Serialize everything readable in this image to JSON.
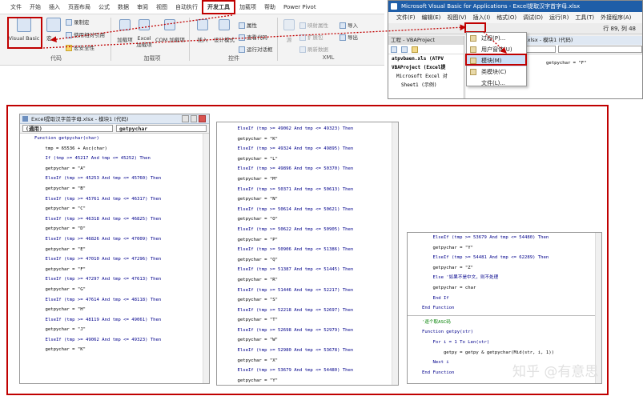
{
  "ribbon": {
    "tabs": [
      "文件",
      "开始",
      "插入",
      "页面布局",
      "公式",
      "数据",
      "审阅",
      "视图",
      "自动执行",
      "开发工具",
      "加载项",
      "帮助",
      "Power Pivot"
    ],
    "active_tab": "开发工具",
    "code_group": {
      "visual_basic": "Visual Basic",
      "macros": "宏",
      "record_macro": "录制宏",
      "relative_ref": "使用相对引用",
      "macro_security": "宏安全性",
      "label": "代码"
    },
    "addins_group": {
      "addins": "加载项",
      "excel_addins": "Excel 加载项",
      "com_addins": "COM 加载项",
      "label": "加载项"
    },
    "controls_group": {
      "insert": "插入",
      "design_mode": "设计模式",
      "properties": "属性",
      "view_code": "查看代码",
      "run_dialog": "运行对话框",
      "label": "控件"
    },
    "xml_group": {
      "source": "源",
      "map_properties": "映射属性",
      "expansion_packs": "扩展包",
      "refresh_data": "刷新数据",
      "import": "导入",
      "export": "导出",
      "label": "XML"
    }
  },
  "vbe": {
    "title": "Microsoft Visual Basic for Applications - Excel提取汉字首字母.xlsx",
    "menu": [
      "文件(F)",
      "编辑(E)",
      "视图(V)",
      "插入(I)",
      "格式(O)",
      "调试(D)",
      "运行(R)",
      "工具(T)",
      "外接程序(A)"
    ],
    "position": "行 89, 列 48",
    "project_title": "工程 - VBAProject",
    "tree": [
      "atpvbaen.xls (ATPV",
      "VBAProject (Excel提",
      "Microsoft Excel 对",
      "Sheet1 (示例)"
    ],
    "code_title": "Excel提取汉字首字母.xlsx - 模块1 (代码)",
    "combo_general": "(通用)",
    "code_line": "getpychar = \"F\"",
    "dropdown": [
      "过程(P)...",
      "用户窗体(U)",
      "模块(M)",
      "类模块(C)",
      "文件(L)..."
    ]
  },
  "code_window": {
    "title": "Excel提取汉字首字母.xlsx - 模块1 (代码)",
    "combo_left": "(通用)",
    "combo_right": "getpychar"
  },
  "code_col1": [
    "Function getpychar(char)",
    "    tmp = 65536 + Asc(char)",
    "    If (tmp >= 45217 And tmp <= 45252) Then",
    "    getpychar = \"A\"",
    "    ElseIf (tmp >= 45253 And tmp <= 45760) Then",
    "    getpychar = \"B\"",
    "    ElseIf (tmp >= 45761 And tmp <= 46317) Then",
    "    getpychar = \"C\"",
    "    ElseIf (tmp >= 46318 And tmp <= 46825) Then",
    "    getpychar = \"D\"",
    "    ElseIf (tmp >= 46826 And tmp <= 47009) Then",
    "    getpychar = \"E\"",
    "    ElseIf (tmp >= 47010 And tmp <= 47296) Then",
    "    getpychar = \"F\"",
    "    ElseIf (tmp >= 47297 And tmp <= 47613) Then",
    "    getpychar = \"G\"",
    "    ElseIf (tmp >= 47614 And tmp <= 48118) Then",
    "    getpychar = \"H\"",
    "    ElseIf (tmp >= 48119 And tmp <= 49061) Then",
    "    getpychar = \"J\"",
    "    ElseIf (tmp >= 49062 And tmp <= 49323) Then",
    "    getpychar = \"K\""
  ],
  "code_col2": [
    "    ElseIf (tmp >= 49062 And tmp <= 49323) Then",
    "    getpychar = \"K\"",
    "    ElseIf (tmp >= 49324 And tmp <= 49895) Then",
    "    getpychar = \"L\"",
    "    ElseIf (tmp >= 49896 And tmp <= 50370) Then",
    "    getpychar = \"M\"",
    "    ElseIf (tmp >= 50371 And tmp <= 50613) Then",
    "    getpychar = \"N\"",
    "    ElseIf (tmp >= 50614 And tmp <= 50621) Then",
    "    getpychar = \"O\"",
    "    ElseIf (tmp >= 50622 And tmp <= 50905) Then",
    "    getpychar = \"P\"",
    "    ElseIf (tmp >= 50906 And tmp <= 51386) Then",
    "    getpychar = \"Q\"",
    "    ElseIf (tmp >= 51387 And tmp <= 51445) Then",
    "    getpychar = \"R\"",
    "    ElseIf (tmp >= 51446 And tmp <= 52217) Then",
    "    getpychar = \"S\"",
    "    ElseIf (tmp >= 52218 And tmp <= 52697) Then",
    "    getpychar = \"T\"",
    "    ElseIf (tmp >= 52698 And tmp <= 52979) Then",
    "    getpychar = \"W\"",
    "    ElseIf (tmp >= 52980 And tmp <= 53678) Then",
    "    getpychar = \"X\"",
    "    ElseIf (tmp >= 53679 And tmp <= 54480) Then",
    "    getpychar = \"Y\""
  ],
  "code_col3a": [
    "    ElseIf (tmp >= 53679 And tmp <= 54480) Then",
    "    getpychar = \"Y\"",
    "    ElseIf (tmp >= 54481 And tmp <= 62289) Then",
    "    getpychar = \"Z\"",
    "    Else '如果不是中文，则不处理",
    "    getpychar = char",
    "    End If",
    "End Function"
  ],
  "code_col3b": [
    "'逐个取ASC码",
    "Function getpy(str)",
    "    For i = 1 To Len(str)",
    "        getpy = getpy & getpychar(Mid(str, i, 1))",
    "    Next i",
    "End Function"
  ],
  "watermark": "知乎 @有意思"
}
